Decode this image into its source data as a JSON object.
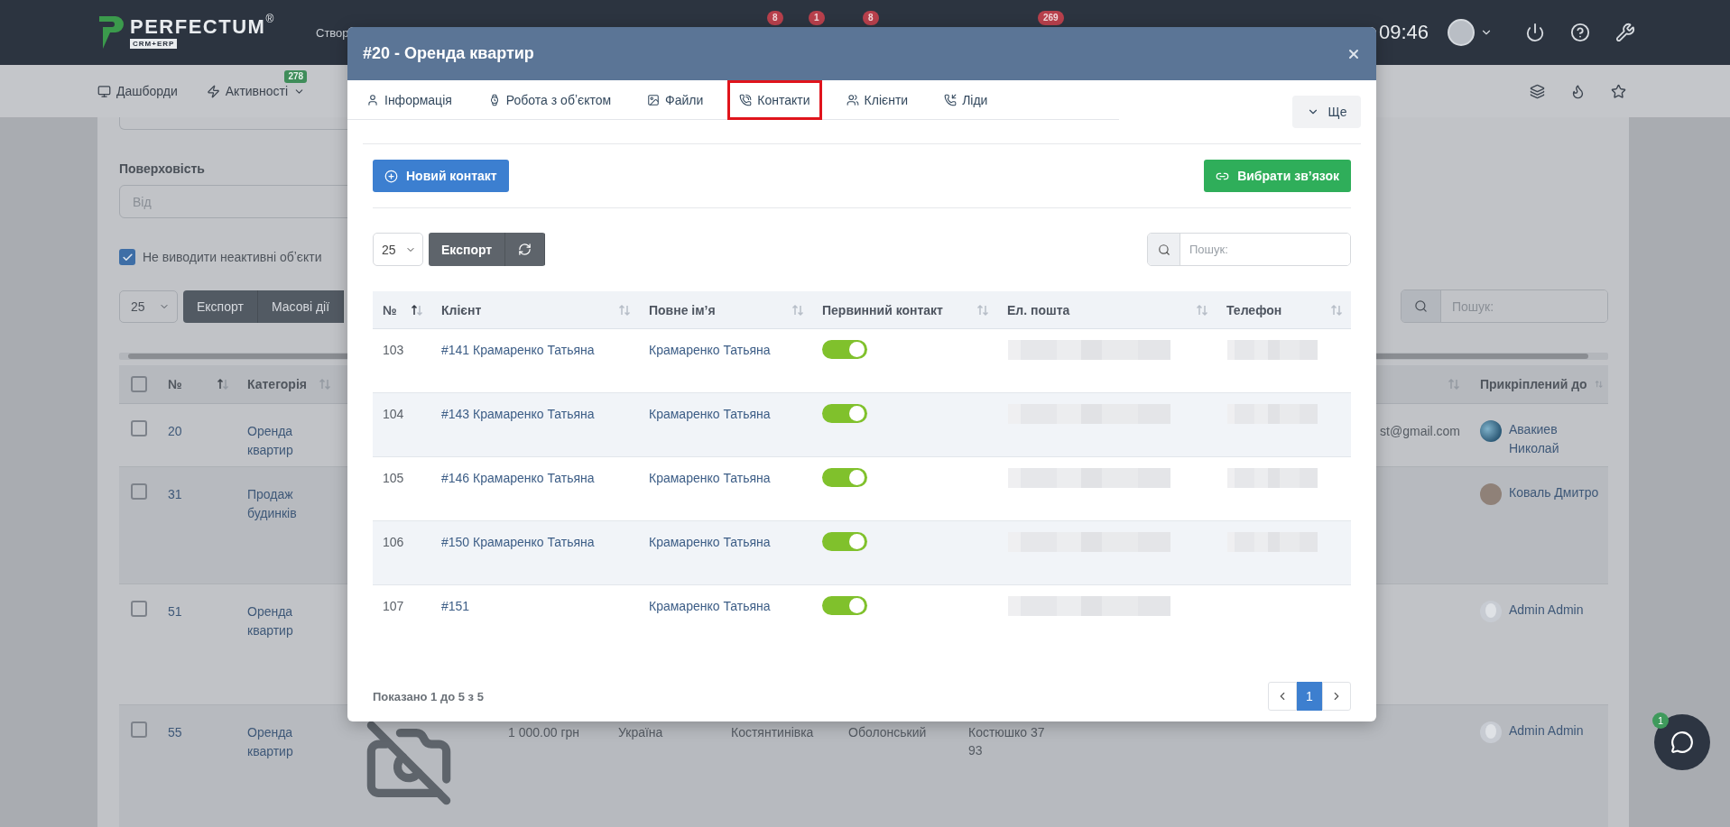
{
  "header": {
    "logo_name": "PERFECTUM",
    "logo_mark": "®",
    "logo_sub": "CRM+ERP",
    "create_label": "Створ",
    "badges": [
      "8",
      "1",
      "8",
      "269"
    ],
    "time": "09:46"
  },
  "navbar": {
    "items": [
      {
        "label": "Дашборди"
      },
      {
        "label": "Активності",
        "badge": "278"
      }
    ]
  },
  "filters": {
    "floor_label": "Поверховість",
    "floor_from_placeholder": "Від",
    "inactive_filter": {
      "label": "Не виводити неактивні обʼєкти",
      "checked": true
    }
  },
  "toolbar": {
    "page_size": "25",
    "buttons": [
      "Експорт",
      "Масові дії"
    ],
    "search_placeholder": "Пошук:"
  },
  "objects_table": {
    "all_checked": false,
    "columns": {
      "number": {
        "label": "№",
        "sorted": true
      },
      "category": {
        "label": "Категорія",
        "sorted": false
      },
      "column_10": {
        "sorted": false
      },
      "attached": {
        "label": "Прикріплений до",
        "sorted": false
      }
    },
    "rows": [
      {
        "checked": false,
        "number": "20",
        "category": "Оренда квартир",
        "email": "st@gmail.com",
        "attached": "Авакиев Николай"
      },
      {
        "checked": false,
        "number": "31",
        "category": "Продаж будинків",
        "attached": "Коваль Дмитро",
        "avatar": {
          "kind": "person"
        }
      },
      {
        "checked": false,
        "number": "51",
        "category": "Оренда квартир",
        "attached": "Admin Admin",
        "avatar": {
          "kind": "default"
        }
      },
      {
        "checked": false,
        "number": "55",
        "category": "Оренда квартир",
        "photo": {
          "kind": "missing"
        },
        "price": "1 000.00 грн",
        "country": "Україна",
        "city": "Костянтинівка",
        "district": "Оболонський",
        "address": "Костюшко 37 93",
        "attached": "Admin Admin",
        "avatar": {
          "kind": "default"
        }
      }
    ]
  },
  "modal": {
    "title": "#20 - Оренда квартир",
    "tabs": [
      {
        "label": "Інформація",
        "selected": false
      },
      {
        "label": "Робота з обʼєктом",
        "selected": false
      },
      {
        "label": "Файли",
        "selected": false
      },
      {
        "label": "Контакти",
        "selected": true
      },
      {
        "label": "Клієнти",
        "selected": false
      },
      {
        "label": "Ліди",
        "selected": false
      }
    ],
    "more_label": "Ще",
    "new_contact": "Новий контакт",
    "pick_link": "Вибрати звʼязок",
    "page_size": "25",
    "export": "Експорт",
    "search_placeholder": "Пошук:",
    "table": {
      "columns": [
        {
          "label": "№",
          "sorted": true
        },
        {
          "label": "Клієнт",
          "sorted": false
        },
        {
          "label": "Повне імʼя",
          "sorted": false
        },
        {
          "label": "Первинний контакт",
          "sorted": false
        },
        {
          "label": "Ел. пошта",
          "sorted": false
        },
        {
          "label": "Телефон",
          "sorted": false
        }
      ],
      "rows": [
        {
          "number": "103",
          "client": "#141 Крамаренко Татьяна",
          "full_name": "Крамаренко Татьяна",
          "primary": true,
          "email_blurred": true,
          "phone_blurred": true
        },
        {
          "number": "104",
          "client": "#143 Крамаренко Татьяна",
          "full_name": "Крамаренко Татьяна",
          "primary": true,
          "email_blurred": true,
          "phone_blurred": true
        },
        {
          "number": "105",
          "client": "#146 Крамаренко Татьяна",
          "full_name": "Крамаренко Татьяна",
          "primary": true,
          "email_blurred": true,
          "phone_blurred": true
        },
        {
          "number": "106",
          "client": "#150 Крамаренко Татьяна",
          "full_name": "Крамаренко Татьяна",
          "primary": true,
          "email_blurred": true,
          "phone_blurred": true
        },
        {
          "number": "107",
          "client": "#151",
          "full_name": "Крамаренко Татьяна",
          "primary": true,
          "email_blurred": true,
          "phone_blurred": false
        }
      ]
    },
    "info": "Показано 1 до 5 з 5",
    "pages": [
      {
        "label": "1",
        "selected": true
      }
    ]
  },
  "chat": {
    "badge": "1"
  }
}
